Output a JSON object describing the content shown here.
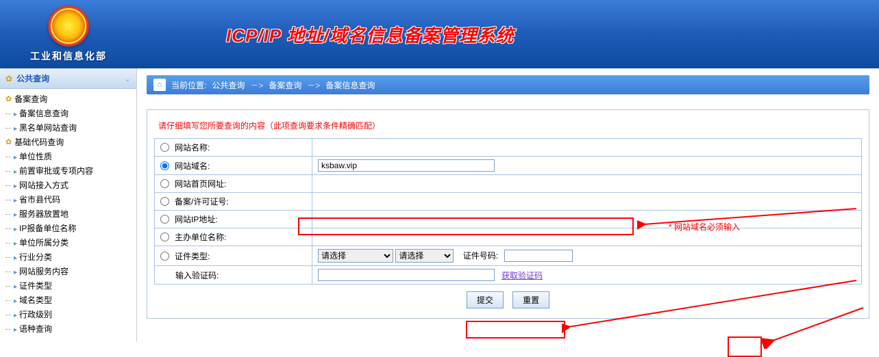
{
  "header": {
    "department": "工业和信息化部",
    "systemTitle": "ICP/IP 地址/域名信息备案管理系统"
  },
  "sidebar": {
    "category": "公共查询",
    "groups": [
      {
        "label": "备案查询",
        "items": [
          {
            "label": "备案信息查询"
          },
          {
            "label": "黑名单网站查询"
          }
        ]
      },
      {
        "label": "基础代码查询",
        "items": [
          {
            "label": "单位性质"
          },
          {
            "label": "前置审批或专项内容"
          },
          {
            "label": "网站接入方式"
          },
          {
            "label": "省市县代码"
          },
          {
            "label": "服务器放置地"
          },
          {
            "label": "IP报备单位名称"
          },
          {
            "label": "单位所属分类"
          },
          {
            "label": "行业分类"
          },
          {
            "label": "网站服务内容"
          },
          {
            "label": "证件类型"
          },
          {
            "label": "域名类型"
          },
          {
            "label": "行政级别"
          },
          {
            "label": "语种查询"
          }
        ]
      }
    ]
  },
  "breadcrumb": {
    "prefix": "当前位置:",
    "items": [
      "公共查询",
      "备案查询",
      "备案信息查询"
    ],
    "sep": "－>"
  },
  "form": {
    "note": "请仔细填写您所要查询的内容（此项查询要求条件精确匹配）",
    "rows": {
      "siteName": "网站名称:",
      "domain": "网站域名:",
      "homepage": "网站首页网址:",
      "license": "备案/许可证号:",
      "ip": "网站IP地址:",
      "sponsor": "主办单位名称:",
      "certType": "证件类型:",
      "captcha": "输入验证码:"
    },
    "domainValue": "ksbaw.vip",
    "selectPlaceholder": "请选择",
    "certNoLabel": "证件号码:",
    "captchaLink": "获取验证码",
    "requiredNote": "* 网站域名必须输入",
    "submit": "提交",
    "reset": "重置"
  }
}
